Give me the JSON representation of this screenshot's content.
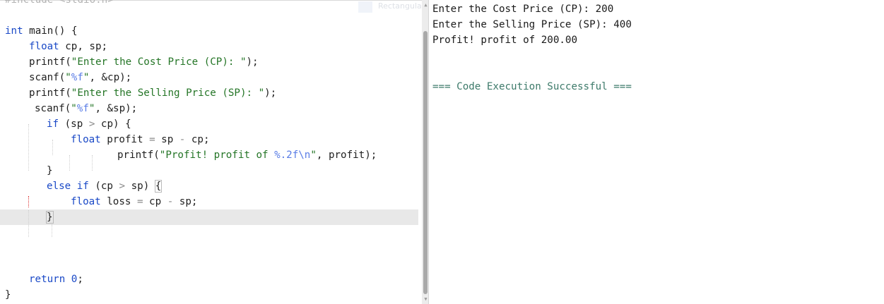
{
  "editor": {
    "include_line": "#include <stdio.h>",
    "main_kw": "int",
    "main_rest": " main() {",
    "float1_kw": "float",
    "float1_rest": " cp, sp;",
    "printf1_fn": "printf(",
    "printf1_str": "\"Enter the Cost Price (CP): \"",
    "printf1_end": ");",
    "scanf1_fn": "scanf(",
    "scanf1_q1": "\"",
    "scanf1_fmt": "%f",
    "scanf1_q2": "\"",
    "scanf1_rest": ", &cp);",
    "printf2_fn": "printf(",
    "printf2_str": "\"Enter the Selling Price (SP): \"",
    "printf2_end": ");",
    "scanf2_fn": "scanf(",
    "scanf2_q1": "\"",
    "scanf2_fmt": "%f",
    "scanf2_q2": "\"",
    "scanf2_rest": ", &sp);",
    "if_kw": "if",
    "if_a": " (sp ",
    "if_op": ">",
    "if_b": " cp) {",
    "float2_kw": "float",
    "float2_a": " profit ",
    "float2_eq": "=",
    "float2_b": " sp ",
    "float2_minus": "-",
    "float2_c": " cp;",
    "printf3_fn": "printf(",
    "printf3_str": "\"Profit! profit of ",
    "printf3_fmt": "%.2f\\n",
    "printf3_str_end": "\"",
    "printf3_rest": ", profit);",
    "close1": "}",
    "else_kw": "else",
    "else_sp": " ",
    "elseif_kw": "if",
    "elseif_a": " (cp ",
    "elseif_op": ">",
    "elseif_b": " sp) ",
    "elseif_brace": "{",
    "float3_kw": "float",
    "float3_a": " loss ",
    "float3_eq": "=",
    "float3_b": " cp ",
    "float3_minus": "-",
    "float3_c": " sp;",
    "close2": "}",
    "return_kw": "return",
    "return_sp": " ",
    "return_num": "0",
    "return_end": ";",
    "close_main": "}"
  },
  "overlay_chip": {
    "label": "Rectangular"
  },
  "console": {
    "lines": [
      "Enter the Cost Price (CP): 200",
      "Enter the Selling Price (SP): 400",
      "Profit! profit of 200.00"
    ],
    "status": "=== Code Execution Successful ==="
  },
  "colors": {
    "keyword": "#1a49c7",
    "string": "#247526",
    "format_specifier": "#5a7de6",
    "success": "#3d7a6a",
    "current_line": "#e8e8e8"
  },
  "icons": [
    "scroll-up-arrow-icon",
    "scroll-down-arrow-icon",
    "selection-tool-icon"
  ]
}
